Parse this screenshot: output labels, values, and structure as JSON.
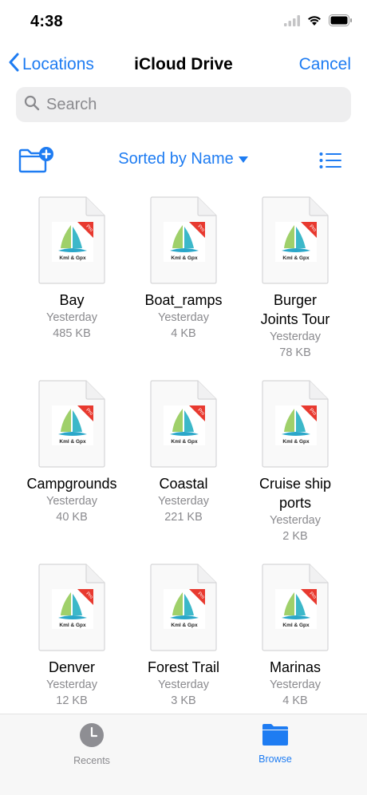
{
  "status": {
    "time": "4:38"
  },
  "nav": {
    "back_label": "Locations",
    "title": "iCloud Drive",
    "cancel_label": "Cancel"
  },
  "search": {
    "placeholder": "Search"
  },
  "toolbar": {
    "sort_label": "Sorted by Name"
  },
  "files": [
    {
      "name": "Bay",
      "date": "Yesterday",
      "size": "485 KB"
    },
    {
      "name": "Boat_ramps",
      "date": "Yesterday",
      "size": "4 KB"
    },
    {
      "name": "Burger Joints Tour",
      "date": "Yesterday",
      "size": "78 KB"
    },
    {
      "name": "Campgrounds",
      "date": "Yesterday",
      "size": "40 KB"
    },
    {
      "name": "Coastal",
      "date": "Yesterday",
      "size": "221 KB"
    },
    {
      "name": "Cruise ship ports",
      "date": "Yesterday",
      "size": "2 KB"
    },
    {
      "name": "Denver",
      "date": "Yesterday",
      "size": "12 KB"
    },
    {
      "name": "Forest Trail",
      "date": "Yesterday",
      "size": "3 KB"
    },
    {
      "name": "Marinas",
      "date": "Yesterday",
      "size": "4 KB"
    }
  ],
  "file_logo": {
    "caption": "Kml & Gpx",
    "ribbon": "Pro"
  },
  "tabs": {
    "recents_label": "Recents",
    "browse_label": "Browse"
  },
  "colors": {
    "accent": "#1e7cf2",
    "secondary_text": "#8a8a8e",
    "ribbon": "#e8392f"
  }
}
